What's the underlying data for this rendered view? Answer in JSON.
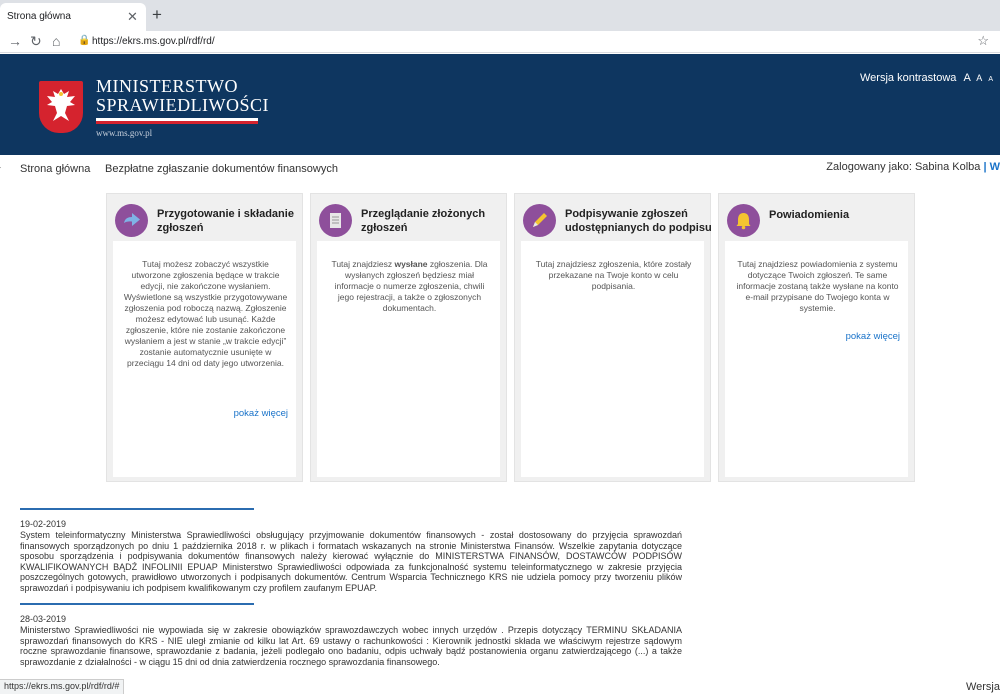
{
  "browser": {
    "tab_title": "Strona główna",
    "tab_close": "✕",
    "new_tab": "+",
    "url": "https://ekrs.ms.gov.pl/rdf/rd/",
    "status_url": "https://ekrs.ms.gov.pl/rdf/rd/#"
  },
  "header": {
    "logo_line1": "MINISTERSTWO",
    "logo_line2": "SPRAWIEDLIWOŚCI",
    "logo_url": "www.ms.gov.pl",
    "contrast_label": "Wersja kontrastowa",
    "font_large": "A",
    "font_medium": "A",
    "font_small": "A"
  },
  "nav": {
    "home": "Strona główna",
    "free_filing": "Bezpłatne zgłaszanie dokumentów finansowych",
    "logged_in": "Zalogowany jako: Sabina Kolba",
    "separator": "| W"
  },
  "cards": [
    {
      "title": "Przygotowanie i składanie zgłoszeń",
      "text": "Tutaj możesz zobaczyć wszystkie utworzone zgłoszenia będące w trakcie edycji, nie zakończone wysłaniem. Wyświetlone są wszystkie przygotowywane zgłoszenia pod roboczą nazwą. Zgłoszenie możesz edytować lub usunąć. Każde zgłoszenie, które nie zostanie zakończone wysłaniem a jest w stanie „w trakcie edycji” zostanie automatycznie usunięte w przeciągu 14 dni od daty jego utworzenia.",
      "more": "pokaż więcej",
      "icon": "arrow-right-icon"
    },
    {
      "title": "Przeglądanie złożonych zgłoszeń",
      "text_before": "Tutaj znajdziesz ",
      "text_bold": "wysłane",
      "text_after": " zgłoszenia. Dla wysłanych zgłoszeń będziesz miał informacje o numerze zgłoszenia, chwili jego rejestracji, a także o zgłoszonych dokumentach.",
      "icon": "document-icon"
    },
    {
      "title": "Podpisywanie zgłoszeń udostępnianych do podpisu",
      "text": "Tutaj znajdziesz zgłoszenia, które zostały przekazane na Twoje konto w celu podpisania.",
      "icon": "pen-icon"
    },
    {
      "title": "Powiadomienia",
      "text": "Tutaj znajdziesz powiadomienia z systemu dotyczące Twoich zgłoszeń. Te same informacje zostaną także wysłane na konto e-mail przypisane do Twojego konta w systemie.",
      "more": "pokaż więcej",
      "icon": "bell-icon"
    }
  ],
  "news": [
    {
      "date": "19-02-2019",
      "text": "System teleinformatyczny Ministerstwa Sprawiedliwości obsługujący przyjmowanie dokumentów finansowych - został dostosowany do przyjęcia sprawozdań finansowych sporządzonych po dniu 1 października 2018 r. w plikach i formatach wskazanych na stronie Ministerstwa Finansów. Wszelkie zapytania dotyczące sposobu sporządzenia i podpisywania dokumentów finansowych należy kierować wyłącznie do MINISTERSTWA FINANSÓW, DOSTAWCÓW PODPISÓW KWALIFIKOWANYCH BĄDŹ INFOLINII EPUAP Ministerstwo Sprawiedliwości odpowiada za funkcjonalność systemu teleinformatycznego w zakresie przyjęcia poszczególnych gotowych, prawidłowo utworzonych i podpisanych dokumentów. Centrum Wsparcia Technicznego KRS nie udziela pomocy przy tworzeniu plików sprawozdań i podpisywaniu ich podpisem kwalifikowanym czy profilem zaufanym EPUAP."
    },
    {
      "date": "28-03-2019",
      "text": "Ministerstwo Sprawiedliwości nie wypowiada się w zakresie obowiązków sprawozdawczych wobec innych urzędów . Przepis dotyczący TERMINU SKŁADANIA sprawozdań finansowych do KRS - NIE uległ zmianie od kilku lat Art. 69 ustawy o rachunkowości : Kierownik jednostki składa we właściwym rejestrze sądowym roczne sprawozdanie finansowe, sprawozdanie z badania, jeżeli podlegało ono badaniu, odpis uchwały bądź postanowienia organu zatwierdzającego (...) a także sprawozdanie z działalności - w ciągu 15 dni od dnia zatwierdzenia rocznego sprawozdania finansowego."
    }
  ],
  "corner_text": "Wersja"
}
